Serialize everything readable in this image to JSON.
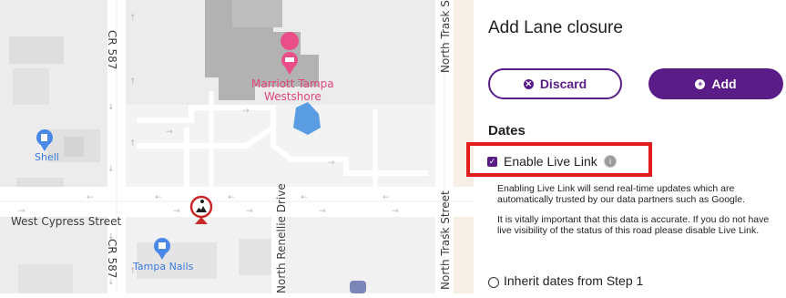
{
  "map": {
    "street_labels": {
      "cr587_top": "CR 587",
      "cr587_bottom": "CR 587",
      "north_trask_top": "North Trask S",
      "north_trask_bottom": "North Trask Street",
      "north_renellie": "North Renellie Drive",
      "west_cypress": "West Cypress Street"
    },
    "places": {
      "marriott": "Marriott Tampa Westshore",
      "marriott_line1": "Marriott Tampa",
      "marriott_line2": "Westshore",
      "shell": "Shell",
      "tampa_nails": "Tampa Nails"
    },
    "colors": {
      "map_bg": "#f6efe6",
      "block": "#ececec",
      "building": "#b2b2b2",
      "road": "#ffffff",
      "water": "#5b9de3",
      "hotel_pin": "#ea4e89",
      "place_pin": "#4a88e8",
      "closure_marker_ring": "#c62828"
    }
  },
  "panel": {
    "title": "Add Lane closure",
    "discard_label": "Discard",
    "add_label": "Add",
    "dates_heading": "Dates",
    "enable_live_link_label": "Enable Live Link",
    "enable_live_link_checked": true,
    "paragraph1": "Enabling Live Link will send real-time updates which are automatically trusted by our data partners such as Google.",
    "paragraph2": "It is vitally important that this data is accurate. If you do not have live visibility of the status of this road please disable Live Link.",
    "inherit_label": "Inherit dates from Step 1",
    "accent_color": "#5a1d87",
    "highlight_color": "#e11d1d"
  }
}
